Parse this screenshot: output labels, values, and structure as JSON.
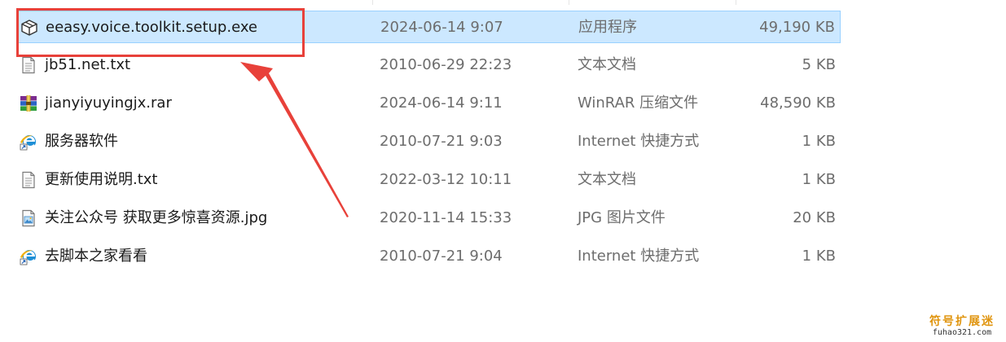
{
  "files": [
    {
      "name": "eeasy.voice.toolkit.setup.exe",
      "date": "2024-06-14 9:07",
      "type": "应用程序",
      "size": "49,190 KB",
      "icon": "package-icon",
      "selected": true
    },
    {
      "name": "jb51.net.txt",
      "date": "2010-06-29 22:23",
      "type": "文本文档",
      "size": "5 KB",
      "icon": "text-file-icon",
      "selected": false
    },
    {
      "name": "jianyiyuyingjx.rar",
      "date": "2024-06-14 9:11",
      "type": "WinRAR 压缩文件",
      "size": "48,590 KB",
      "icon": "winrar-archive-icon",
      "selected": false
    },
    {
      "name": "服务器软件",
      "date": "2010-07-21 9:03",
      "type": "Internet 快捷方式",
      "size": "1 KB",
      "icon": "internet-shortcut-icon",
      "selected": false
    },
    {
      "name": "更新使用说明.txt",
      "date": "2022-03-12 10:11",
      "type": "文本文档",
      "size": "1 KB",
      "icon": "text-file-icon",
      "selected": false
    },
    {
      "name": "关注公众号 获取更多惊喜资源.jpg",
      "date": "2020-11-14 15:33",
      "type": "JPG 图片文件",
      "size": "20 KB",
      "icon": "image-file-icon",
      "selected": false
    },
    {
      "name": "去脚本之家看看",
      "date": "2010-07-21 9:04",
      "type": "Internet 快捷方式",
      "size": "1 KB",
      "icon": "internet-shortcut-icon",
      "selected": false
    }
  ],
  "annotation": {
    "box_color": "#e8413a",
    "arrow_color": "#e8413a"
  },
  "watermark": {
    "title": "符号扩展迷",
    "site": "fuhao321.com"
  },
  "colors": {
    "selection_bg": "#cce8ff",
    "selection_border": "#99d1ff"
  }
}
